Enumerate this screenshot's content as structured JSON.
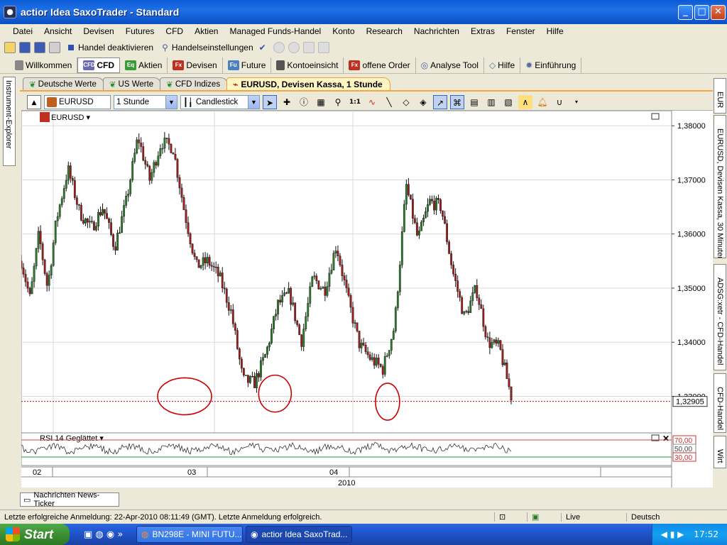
{
  "window": {
    "title": "actior Idea SaxoTrader - Standard",
    "buttons": [
      "_",
      "□",
      "✕"
    ]
  },
  "menu": [
    "Datei",
    "Ansicht",
    "Devisen",
    "Futures",
    "CFD",
    "Aktien",
    "Managed Funds-Handel",
    "Konto",
    "Research",
    "Nachrichten",
    "Extras",
    "Fenster",
    "Hilfe"
  ],
  "toolbar": {
    "trade_off": "Handel deaktivieren",
    "trade_settings": "Handelseinstellungen"
  },
  "nav": [
    {
      "label": "Willkommen",
      "badge": "",
      "color": "#888888"
    },
    {
      "label": "CFD",
      "badge": "CFD",
      "color": "#6a6ab0"
    },
    {
      "label": "Aktien",
      "badge": "Eq",
      "color": "#3a9a3a"
    },
    {
      "label": "Devisen",
      "badge": "Fx",
      "color": "#c03020"
    },
    {
      "label": "Future",
      "badge": "Fu",
      "color": "#4a80c0"
    },
    {
      "label": "Kontoeinsicht",
      "badge": "",
      "color": "#555555"
    },
    {
      "label": "offene Order",
      "badge": "Fx",
      "color": "#c03020"
    },
    {
      "label": "Analyse Tool",
      "badge": "",
      "color": "#5060a0"
    },
    {
      "label": "Hilfe",
      "badge": "",
      "color": "#5a6aa0"
    },
    {
      "label": "Einführung",
      "badge": "",
      "color": "#5a6aa0"
    }
  ],
  "doc_tabs": [
    {
      "label": "Deutsche Werte",
      "active": false
    },
    {
      "label": "US Werte",
      "active": false
    },
    {
      "label": "CFD Indizes",
      "active": false
    },
    {
      "label": "EURUSD, Devisen Kassa, 1 Stunde",
      "active": true
    }
  ],
  "left_panel_tab": "Instrument-Explorer",
  "right_panel_tabs": [
    "EUR",
    "EURUSD, Devisen Kassa, 30 Minuten",
    "ADSG:xetr - CFD-Handel",
    "CFD-Handel",
    "Wirt"
  ],
  "chart_controls": {
    "symbol": "EURUSD",
    "interval": "1 Stunde",
    "style": "Candlestick"
  },
  "chart_data": {
    "type": "candlestick",
    "instrument": "EURUSD",
    "yaxis": {
      "ticks": [
        "1,38000",
        "1,37000",
        "1,36000",
        "1,35000",
        "1,34000",
        "1,33000"
      ],
      "ylim": [
        1.3235,
        1.382
      ],
      "current_price_label": "1,32905",
      "current_price": 1.32905
    },
    "xaxis": {
      "ticks": [
        "02",
        "03",
        "04"
      ],
      "year_label": "2010"
    },
    "series": [
      {
        "name": "EURUSD",
        "x_days": [
          0.0,
          1.5,
          3.0,
          4.5,
          6.0,
          8.0,
          10.0,
          12.0,
          14.0,
          16.0,
          18.0,
          20.0,
          22.0,
          24.0,
          26.0,
          28.0,
          30.0,
          32.0,
          34.0,
          36.0,
          38.0,
          40.0,
          42.0,
          44.0,
          46.0,
          48.0,
          50.0,
          52.0,
          54.0,
          56.0,
          58.0,
          60.0,
          62.0,
          64.0,
          66.0,
          68.0,
          70.0,
          72.0,
          74.0,
          76.0,
          78.0,
          80.0,
          82.0,
          84.0
        ],
        "close": [
          1.355,
          1.348,
          1.36,
          1.35,
          1.3625,
          1.372,
          1.364,
          1.361,
          1.365,
          1.3575,
          1.366,
          1.378,
          1.37,
          1.377,
          1.376,
          1.364,
          1.354,
          1.355,
          1.352,
          1.3455,
          1.333,
          1.3325,
          1.338,
          1.347,
          1.349,
          1.34,
          1.352,
          1.3495,
          1.358,
          1.348,
          1.3395,
          1.3368,
          1.335,
          1.343,
          1.369,
          1.359,
          1.366,
          1.365,
          1.353,
          1.3445,
          1.35,
          1.34,
          1.339,
          1.33
        ]
      }
    ],
    "annotations": [
      {
        "shape": "ellipse",
        "color": "#cc0000",
        "at_day": 28.0,
        "level": 1.33
      },
      {
        "shape": "ellipse",
        "color": "#cc0000",
        "at_day": 43.5,
        "level": 1.3305
      },
      {
        "shape": "ellipse",
        "color": "#cc0000",
        "at_day": 62.8,
        "level": 1.329
      }
    ],
    "indicator": {
      "name": "RSI 14 Geglättet",
      "levels": [
        "70,00",
        "50,00",
        "30,00"
      ]
    }
  },
  "news_ticker": "Nachrichten News-Ticker",
  "status": {
    "login": "Letzte erfolgreiche Anmeldung: 22-Apr-2010 08:11:49 (GMT). Letzte Anmeldung erfolgreich.",
    "mode": "Live",
    "language": "Deutsch"
  },
  "taskbar": {
    "start": "Start",
    "items": [
      "BN298E - MINI FUTU...",
      "actior Idea SaxoTrad..."
    ],
    "clock": "17:52"
  }
}
